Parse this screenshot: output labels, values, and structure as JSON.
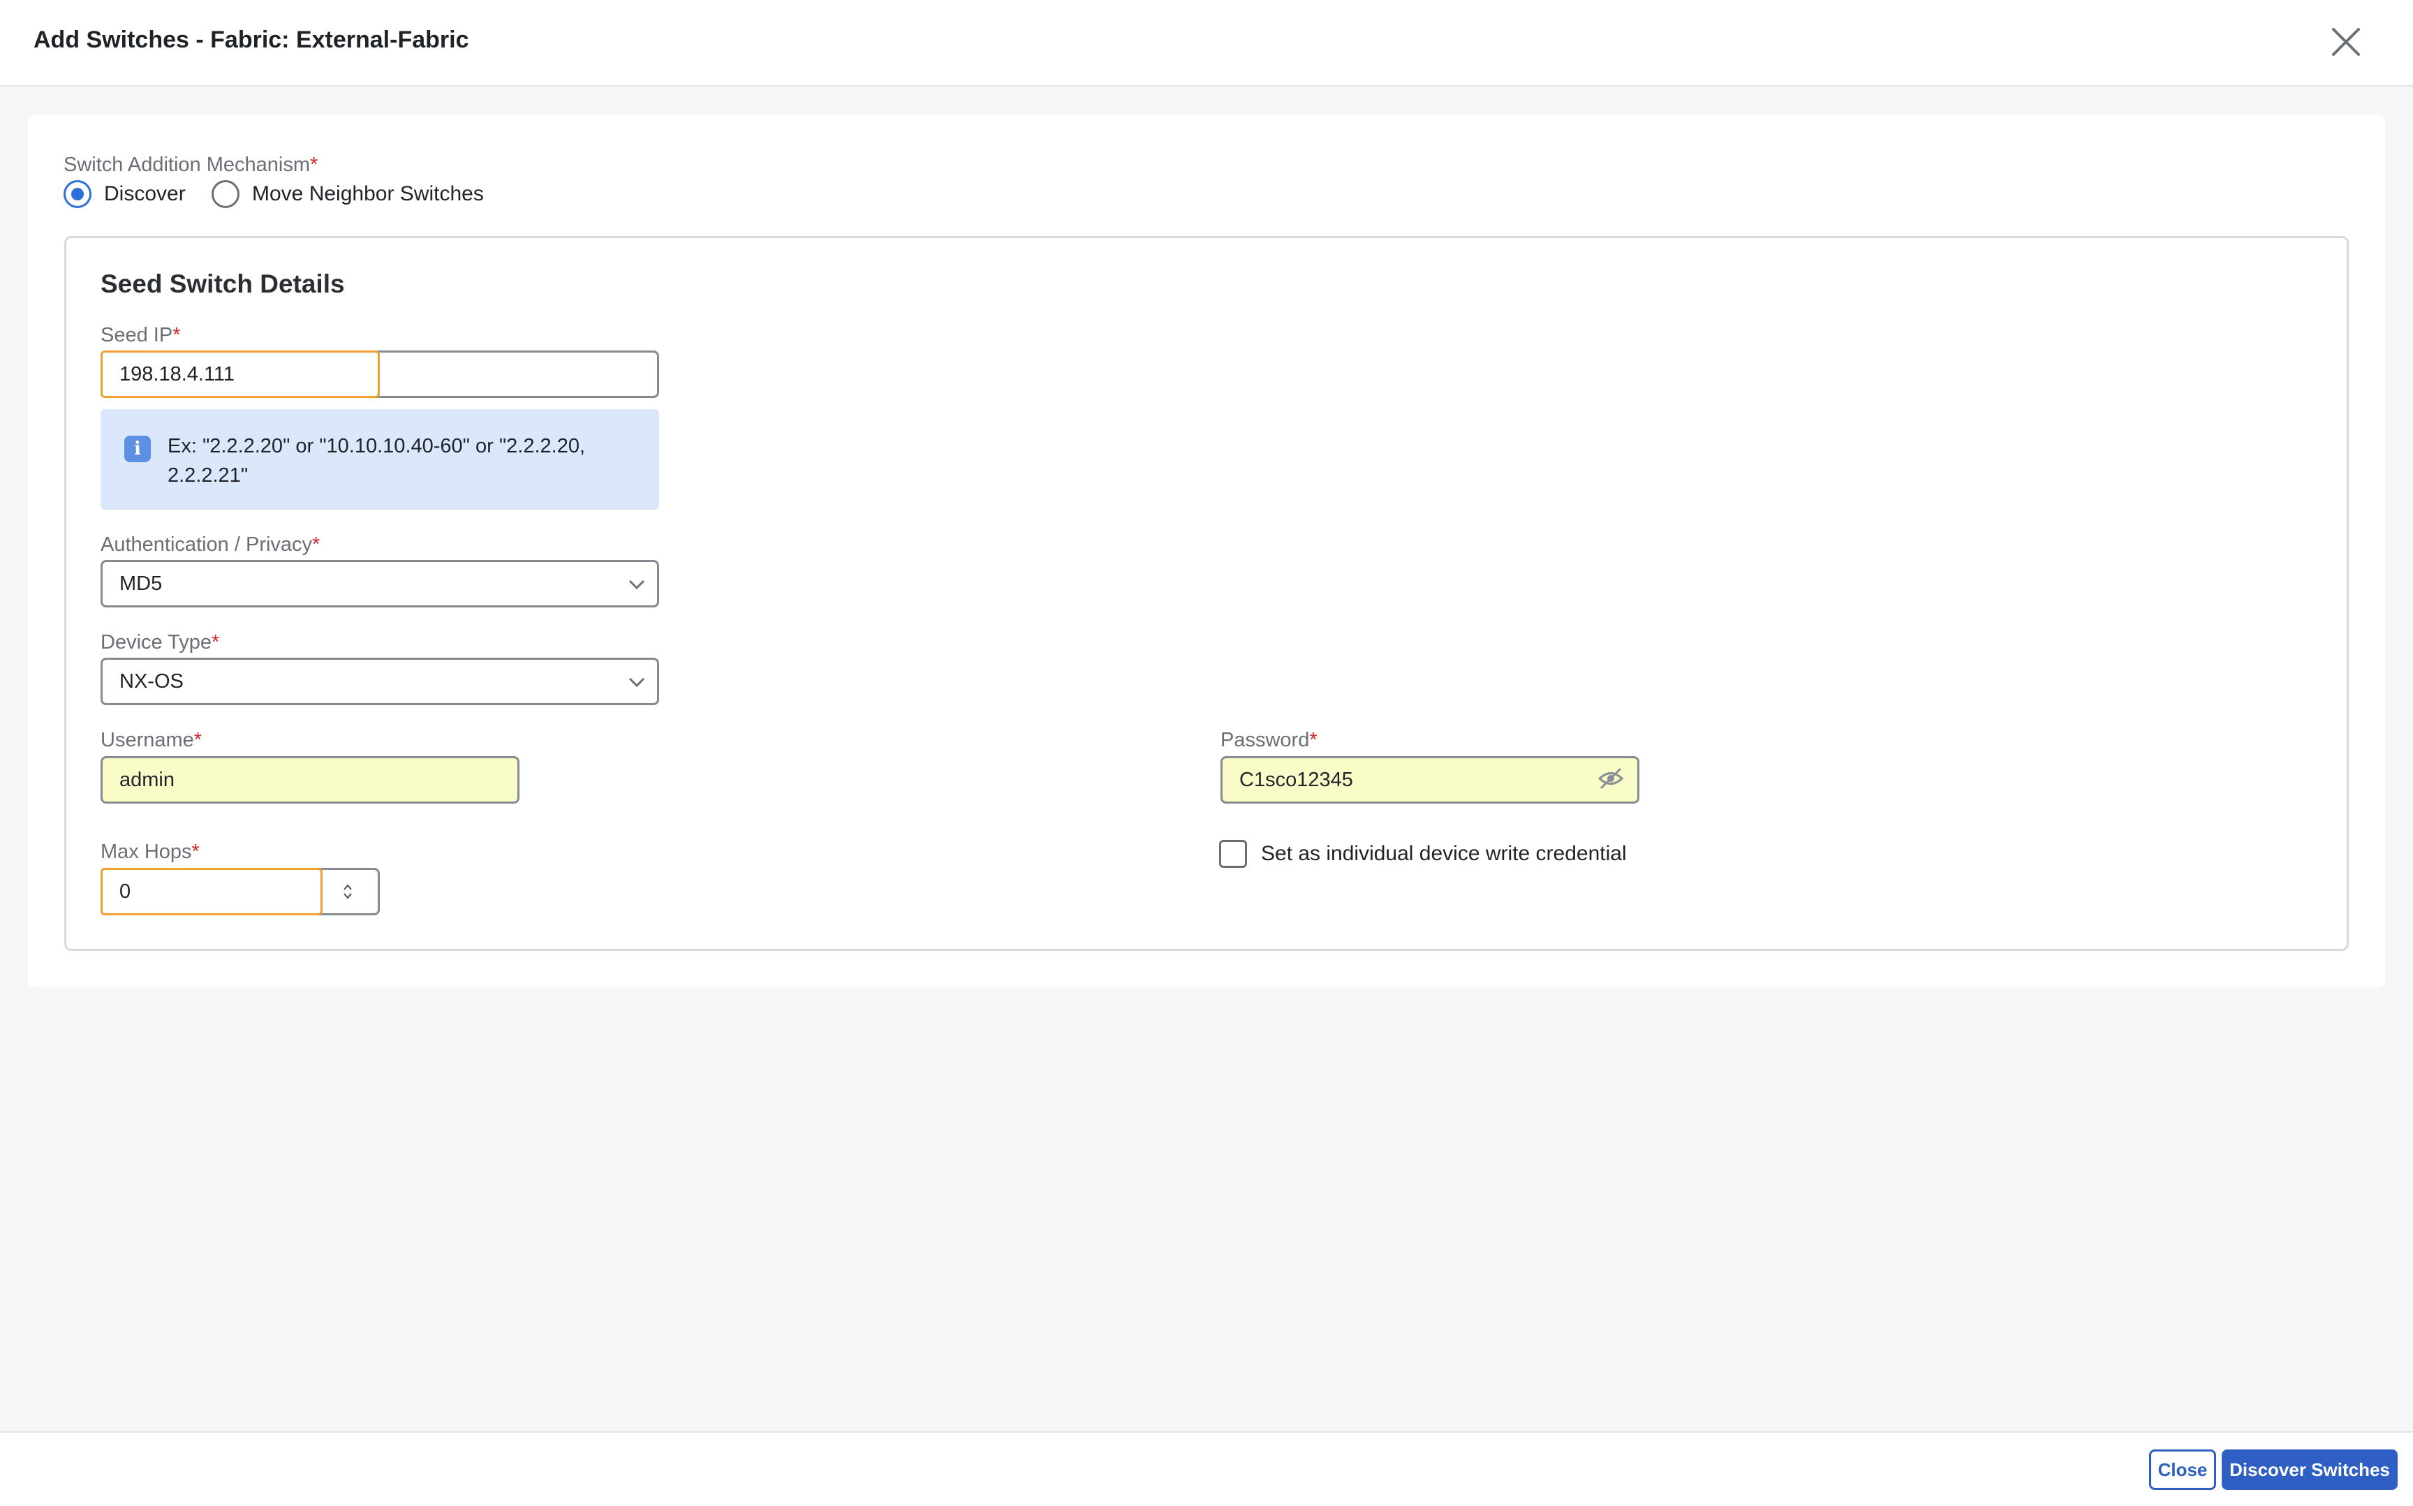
{
  "header": {
    "title": "Add Switches - Fabric: External-Fabric"
  },
  "mechanism": {
    "label": "Switch Addition Mechanism",
    "required": "*",
    "options": [
      {
        "label": "Discover",
        "checked": true
      },
      {
        "label": "Move Neighbor Switches",
        "checked": false
      }
    ]
  },
  "seed": {
    "title": "Seed Switch Details",
    "seed_ip": {
      "label": "Seed IP",
      "value": "198.18.4.111"
    },
    "info": "Ex: \"2.2.2.20\" or \"10.10.10.40-60\" or \"2.2.2.20, 2.2.2.21\"",
    "auth": {
      "label": "Authentication / Privacy",
      "value": "MD5"
    },
    "device_type": {
      "label": "Device Type",
      "value": "NX-OS"
    },
    "username": {
      "label": "Username",
      "value": "admin"
    },
    "password": {
      "label": "Password",
      "value": "C1sco12345"
    },
    "max_hops": {
      "label": "Max Hops",
      "value": "0"
    },
    "write_credential": {
      "label": "Set as individual device write credential",
      "checked": false
    }
  },
  "footer": {
    "close_label": "Close",
    "discover_label": "Discover Switches"
  },
  "colors": {
    "accent": "#2f5fc4",
    "focus": "#f0a033",
    "autofill": "#fafcc8",
    "info_bg": "#dbe7fb"
  }
}
